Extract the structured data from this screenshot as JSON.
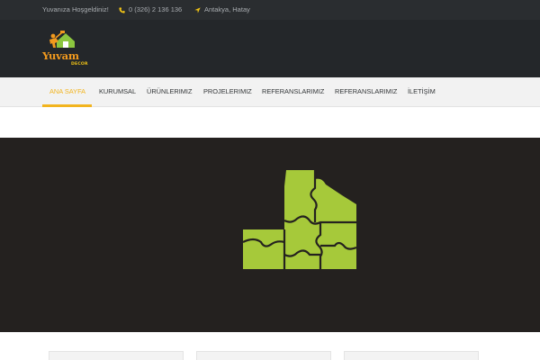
{
  "topbar": {
    "welcome": "Yuvanıza Hoşgeldiniz!",
    "phone": "0 (326) 2 136 136",
    "location": "Antakya, Hatay",
    "accent_color": "#f2c415",
    "icons": [
      "phone-icon",
      "location-arrow-icon"
    ]
  },
  "brand": {
    "name": "Yuvam",
    "tagline": "DECOR",
    "primary_color": "#f29a1e",
    "secondary_color": "#8cc63f"
  },
  "nav": {
    "active_color": "#f2b41e",
    "items": [
      {
        "label": "ANA SAYFA",
        "active": true
      },
      {
        "label": "KURUMSAL",
        "active": false
      },
      {
        "label": "ÜRÜNLERIMIZ",
        "active": false
      },
      {
        "label": "PROJELERIMIZ",
        "active": false
      },
      {
        "label": "REFERANSLARIMIZ",
        "active": false
      },
      {
        "label": "REFERANSLARIMIZ",
        "active": false
      },
      {
        "label": "İLETİŞİM",
        "active": false
      }
    ]
  },
  "hero": {
    "background_color": "#24211f",
    "graphic": "puzzle-house-icon",
    "graphic_color": "#a6c93a"
  }
}
